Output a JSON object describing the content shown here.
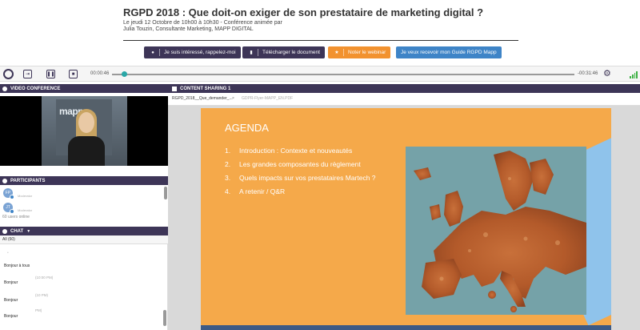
{
  "header": {
    "title": "RGPD 2018 : Que doit-on exiger de son prestataire de marketing digital ?",
    "subtitle": "Le jeudi 12 Octobre de 10h00 à 10h30 - Conférence animée par",
    "presenter": "Julia Touzin, Consultante Marketing, MAPP DIGITAL"
  },
  "actions": {
    "callback_label": "Je suis intéressé, rappelez-moi",
    "download_label": "Télécharger le document",
    "rate_label": "Noter le webinar",
    "guide_label": "Je veux recevoir mon Guide RGPD Mapp"
  },
  "player": {
    "elapsed": "00:00:46",
    "remaining": "-00:31:46",
    "progress_fraction": 0.02
  },
  "video": {
    "header": "VIDEO CONFERENCE",
    "wall_text": "mapp"
  },
  "participants": {
    "header": "PARTICIPANTS",
    "items": [
      {
        "initials": "FP",
        "role": "Moderator"
      },
      {
        "initials": "JT",
        "role": "Moderator"
      }
    ],
    "users_online": "60 users online"
  },
  "chat": {
    "header": "CHAT",
    "tab": "All (60)",
    "messages": [
      {
        "text": "Bonjour à tous",
        "time": ""
      },
      {
        "text": "",
        "time": "(10:00 PM)"
      },
      {
        "text": "Bonjour",
        "time": ""
      },
      {
        "text": "",
        "time": "(10 PM)"
      },
      {
        "text": "Bonjour",
        "time": ""
      },
      {
        "text": "",
        "time": "PM)"
      },
      {
        "text": "Bonjour",
        "time": ""
      }
    ]
  },
  "content": {
    "header": "CONTENT SHARING 1",
    "tabs": [
      {
        "label": "RGPD_2018__Que_demander_..."
      },
      {
        "label": "GDPR-Flyer-MAPP_EN.PDF"
      }
    ]
  },
  "slide": {
    "title": "AGENDA",
    "items": [
      {
        "num": "1.",
        "text": "Introduction : Contexte et nouveautés"
      },
      {
        "num": "2.",
        "text": "Les grandes composantes du règlement"
      },
      {
        "num": "3.",
        "text": "Quels impacts sur vos prestataires Martech ?"
      },
      {
        "num": "4.",
        "text": "A retenir /  Q&R"
      }
    ]
  },
  "colors": {
    "brand_dark": "#3d3557",
    "accent_orange": "#f2922f",
    "accent_blue": "#3e84c7",
    "slide_bg": "#f5a94a",
    "signal_green": "#3cb043"
  }
}
